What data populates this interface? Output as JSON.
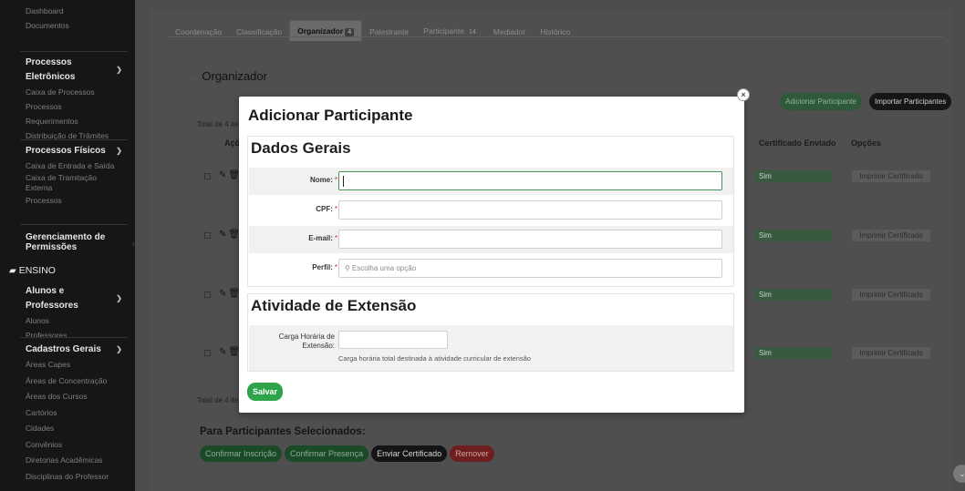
{
  "sidebar": {
    "top_links": [
      "Dashboard",
      "Documentos"
    ],
    "groups": [
      {
        "title": "Processos Eletrônicos",
        "items": [
          "Caixa de Processos",
          "Processos",
          "Requerimentos",
          "Distribuição de Trâmites"
        ]
      },
      {
        "title": "Processos Físicos",
        "items": [
          "Caixa de Entrada e Saída",
          "Caixa de Tramitação",
          "Externa",
          "Processos"
        ]
      },
      {
        "title": "Gerenciamento de",
        "title2": "Permissões",
        "items": []
      }
    ],
    "ensino": "ENSINO",
    "ensino_groups": [
      {
        "title": "Alunos e Professores",
        "items": [
          "Alunos",
          "Professores"
        ]
      },
      {
        "title": "Cadastros Gerais",
        "items": [
          "Áreas Capes",
          "Áreas de Concentração",
          "Áreas dos Cursos",
          "Cartórios",
          "Cidades",
          "Convênios",
          "Diretorias Acadêmicas",
          "Disciplinas do Professor"
        ]
      }
    ]
  },
  "tabs": [
    {
      "label": "Coordenação",
      "badge": ""
    },
    {
      "label": "Classificação",
      "badge": ""
    },
    {
      "label": "Organizador",
      "badge": "4",
      "active": true
    },
    {
      "label": "Palestrante",
      "badge": ""
    },
    {
      "label": "Participante",
      "badge": "14"
    },
    {
      "label": "Mediador",
      "badge": ""
    },
    {
      "label": "Histórico",
      "badge": ""
    }
  ],
  "section_title": "Organizador",
  "buttons": {
    "add_participant": "Adicionar Participante",
    "import_participants": "Importar Participantes"
  },
  "table": {
    "total_label": "Total de 4 itens",
    "col_actions": "Ações",
    "col_certificate_sent": "Certificado Enviado",
    "col_options": "Opções",
    "rows": [
      {
        "certificate_sent": "Sim",
        "option": "Imprimir Certificado"
      },
      {
        "certificate_sent": "Sim",
        "option": "Imprimir Certificado"
      },
      {
        "certificate_sent": "Sim",
        "option": "Imprimir Certificado"
      },
      {
        "certificate_sent": "Sim",
        "option": "Imprimir Certificado"
      }
    ]
  },
  "bulk": {
    "label": "Para Participantes Selecionados:",
    "confirm_inscricao": "Confirmar Inscrição",
    "confirm_presenca": "Confirmar Presença",
    "send_certificate": "Enviar Certificado",
    "remove": "Remover"
  },
  "modal": {
    "title": "Adicionar Participante",
    "close_symbol": "×",
    "panel1_title": "Dados Gerais",
    "fields": {
      "nome_label": "Nome:",
      "nome_value": "",
      "cpf_label": "CPF:",
      "cpf_value": "",
      "email_label": "E-mail:",
      "email_value": "",
      "perfil_label": "Perfil:",
      "perfil_placeholder": "Escolha uma opção",
      "required_mark": "*"
    },
    "panel2_title": "Atividade de Extensão",
    "carga_label_1": "Carga Horária de",
    "carga_label_2": "Extensão:",
    "carga_value": "",
    "carga_help": "Carga horária total destinada à atividade curricular de extensão",
    "save": "Salvar"
  },
  "colors": {
    "accent_green": "#2da34a",
    "danger": "#c0392b",
    "dark": "#161616"
  }
}
